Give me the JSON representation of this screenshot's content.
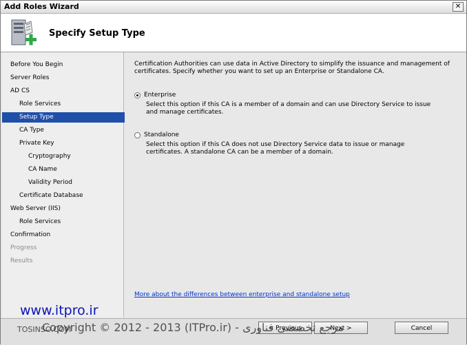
{
  "window": {
    "title": "Add Roles Wizard",
    "close_symbol": "✕",
    "page_title": "Specify Setup Type"
  },
  "sidebar": {
    "items": [
      {
        "label": "Before You Begin",
        "level": 0,
        "state": "normal"
      },
      {
        "label": "Server Roles",
        "level": 0,
        "state": "normal"
      },
      {
        "label": "AD CS",
        "level": 0,
        "state": "normal"
      },
      {
        "label": "Role Services",
        "level": 1,
        "state": "normal"
      },
      {
        "label": "Setup Type",
        "level": 1,
        "state": "selected"
      },
      {
        "label": "CA Type",
        "level": 1,
        "state": "normal"
      },
      {
        "label": "Private Key",
        "level": 1,
        "state": "normal"
      },
      {
        "label": "Cryptography",
        "level": 2,
        "state": "normal"
      },
      {
        "label": "CA Name",
        "level": 2,
        "state": "normal"
      },
      {
        "label": "Validity Period",
        "level": 2,
        "state": "normal"
      },
      {
        "label": "Certificate Database",
        "level": 1,
        "state": "normal"
      },
      {
        "label": "Web Server (IIS)",
        "level": 0,
        "state": "normal"
      },
      {
        "label": "Role Services",
        "level": 1,
        "state": "normal"
      },
      {
        "label": "Confirmation",
        "level": 0,
        "state": "normal"
      },
      {
        "label": "Progress",
        "level": 0,
        "state": "disabled"
      },
      {
        "label": "Results",
        "level": 0,
        "state": "disabled"
      }
    ]
  },
  "content": {
    "intro": "Certification Authorities can use data in Active Directory to simplify the issuance and management of certificates. Specify whether you want to set up an Enterprise or Standalone CA.",
    "options": [
      {
        "label": "Enterprise",
        "checked": true,
        "description": "Select this option if this CA is a member of a domain and can use Directory Service to issue and manage certificates."
      },
      {
        "label": "Standalone",
        "checked": false,
        "description": "Select this option if this CA does not use Directory Service data to issue or manage certificates. A standalone CA can be a member of a domain."
      }
    ],
    "link": "More about the differences between enterprise and standalone setup"
  },
  "footer": {
    "previous_label": "< Previous",
    "next_label": "Next >",
    "cancel_label": "Cancel"
  },
  "watermark": {
    "site": "www.itpro.ir",
    "copyright": "Copyright © 2012 - 2013 (ITPro.ir) - مرجع تخصصی فناوری",
    "left_text": "TOSINSO.COM"
  },
  "colors": {
    "selection": "#1f4fa8",
    "link": "#0033cc",
    "watermark_site": "#0a12b8"
  }
}
